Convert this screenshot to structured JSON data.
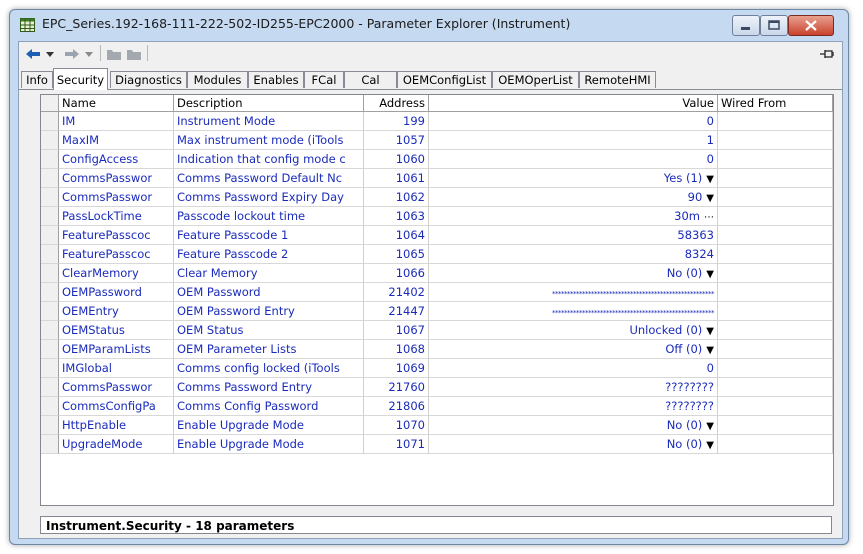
{
  "window": {
    "title": "EPC_Series.192-168-111-222-502-ID255-EPC2000 - Parameter Explorer (Instrument)"
  },
  "toolbar": {
    "back_icon": "back-arrow-icon",
    "forward_icon": "forward-arrow-icon",
    "folder_icon": "folder-icon",
    "pin_icon": "pin-icon"
  },
  "tabs": [
    "Info",
    "Security",
    "Diagnostics",
    "Modules",
    "Enables",
    "FCal",
    "Cal",
    "OEMConfigList",
    "OEMOperList",
    "RemoteHMI"
  ],
  "active_tab": "Security",
  "columns": {
    "name": "Name",
    "description": "Description",
    "address": "Address",
    "value": "Value",
    "wired": "Wired From"
  },
  "rows": [
    {
      "name": "IM",
      "description": "Instrument Mode",
      "address": "199",
      "value": "0",
      "control": ""
    },
    {
      "name": "MaxIM",
      "description": "Max instrument mode (iTools",
      "address": "1057",
      "value": "1",
      "control": ""
    },
    {
      "name": "ConfigAccess",
      "description": "Indication that config mode c",
      "address": "1060",
      "value": "0",
      "control": ""
    },
    {
      "name": "CommsPasswor",
      "description": "Comms Password Default Nc",
      "address": "1061",
      "value": "Yes (1)",
      "control": "dropdown"
    },
    {
      "name": "CommsPasswor",
      "description": "Comms Password Expiry Day",
      "address": "1062",
      "value": "90",
      "control": "dropdown"
    },
    {
      "name": "PassLockTime",
      "description": "Passcode lockout time",
      "address": "1063",
      "value": "30m",
      "control": "ellipsis"
    },
    {
      "name": "FeaturePasscoc",
      "description": "Feature Passcode 1",
      "address": "1064",
      "value": "58363",
      "control": ""
    },
    {
      "name": "FeaturePasscoc",
      "description": "Feature Passcode 2",
      "address": "1065",
      "value": "8324",
      "control": ""
    },
    {
      "name": "ClearMemory",
      "description": "Clear Memory",
      "address": "1066",
      "value": "No (0)",
      "control": "dropdown"
    },
    {
      "name": "OEMPassword",
      "description": "OEM Password",
      "address": "21402",
      "value": "******************************************************",
      "control": "stars"
    },
    {
      "name": "OEMEntry",
      "description": "OEM Password Entry",
      "address": "21447",
      "value": "******************************************************",
      "control": "stars"
    },
    {
      "name": "OEMStatus",
      "description": "OEM Status",
      "address": "1067",
      "value": "Unlocked (0)",
      "control": "dropdown"
    },
    {
      "name": "OEMParamLists",
      "description": "OEM Parameter Lists",
      "address": "1068",
      "value": "Off (0)",
      "control": "dropdown"
    },
    {
      "name": "IMGlobal",
      "description": "Comms config locked (iTools",
      "address": "1069",
      "value": "0",
      "control": ""
    },
    {
      "name": "CommsPasswor",
      "description": "Comms Password Entry",
      "address": "21760",
      "value": "????????",
      "control": ""
    },
    {
      "name": "CommsConfigPa",
      "description": "Comms Config Password",
      "address": "21806",
      "value": "????????",
      "control": ""
    },
    {
      "name": "HttpEnable",
      "description": "Enable Upgrade Mode",
      "address": "1070",
      "value": "No (0)",
      "control": "dropdown"
    },
    {
      "name": "UpgradeMode",
      "description": "Enable Upgrade Mode",
      "address": "1071",
      "value": "No (0)",
      "control": "dropdown"
    }
  ],
  "status": "Instrument.Security  -  18 parameters"
}
